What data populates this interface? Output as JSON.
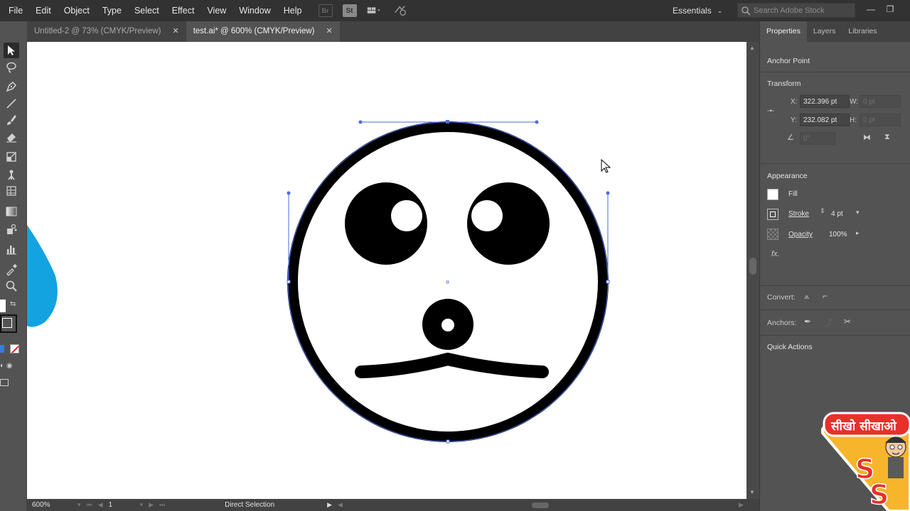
{
  "menubar": {
    "items": [
      "File",
      "Edit",
      "Object",
      "Type",
      "Select",
      "Effect",
      "View",
      "Window",
      "Help"
    ],
    "bridge_icon": "Br",
    "stock_icon": "St",
    "workspace": "Essentials",
    "search_placeholder": "Search Adobe Stock"
  },
  "tabs": [
    {
      "label": "Untitled-2 @ 73% (CMYK/Preview)",
      "active": false
    },
    {
      "label": "test.ai* @ 600% (CMYK/Preview)",
      "active": true
    }
  ],
  "tab_close_glyph": "✕",
  "toolbar": {
    "icons": [
      "direct-selection-icon",
      "lasso-icon",
      "pen-icon",
      "line-icon",
      "paintbrush-icon",
      "eraser-icon",
      "scale-icon",
      "puppet-warp-icon",
      "free-transform-icon",
      "gradient-icon",
      "symbol-sprayer-icon",
      "graph-icon",
      "eyedropper-icon",
      "zoom-icon"
    ]
  },
  "panel": {
    "tabs": [
      "Properties",
      "Layers",
      "Libraries"
    ],
    "selection_type": "Anchor Point",
    "transform": {
      "title": "Transform",
      "x_label": "X:",
      "x_value": "322.396 pt",
      "y_label": "Y:",
      "y_value": "232.082 pt",
      "w_label": "W:",
      "w_value": "0 pt",
      "h_label": "H:",
      "h_value": "0 pt",
      "angle_value": "0°"
    },
    "appearance": {
      "title": "Appearance",
      "fill_label": "Fill",
      "stroke_label": "Stroke",
      "stroke_value": "4 pt",
      "opacity_label": "Opacity",
      "opacity_value": "100%",
      "fx_label": "fx."
    },
    "convert_label": "Convert:",
    "anchors_label": "Anchors:",
    "quick_actions_label": "Quick Actions"
  },
  "statusbar": {
    "zoom": "600%",
    "page": "1",
    "tool": "Direct Selection"
  },
  "logo": {
    "text": "सीखो सीखाओ",
    "letter": "S"
  },
  "colors": {
    "selection": "#4a6de0",
    "shape_blue": "#12a3e0",
    "logo_yellow": "#f7b52b",
    "logo_red": "#e8302a"
  }
}
